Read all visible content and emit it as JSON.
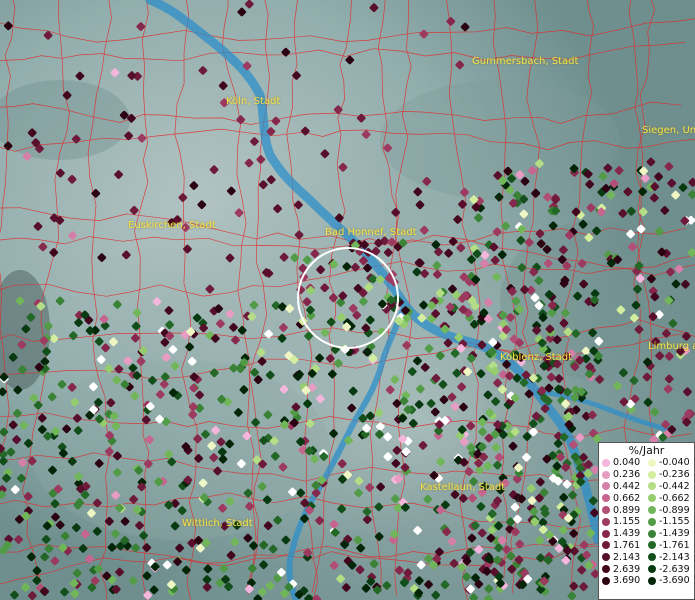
{
  "map": {
    "labels": [
      {
        "id": "koeln",
        "text": "Köln, Stadt"
      },
      {
        "id": "gummersbach",
        "text": "Gummersbach, Stadt"
      },
      {
        "id": "siegen",
        "text": "Siegen, Un"
      },
      {
        "id": "euskirchen",
        "text": "Euskirchen, Stadt"
      },
      {
        "id": "bad-honnef",
        "text": "Bad Honnef, Stadt"
      },
      {
        "id": "koblenz",
        "text": "Koblenz, Stadt"
      },
      {
        "id": "limburg",
        "text": "Limburg a."
      },
      {
        "id": "kastellaun",
        "text": "Kastellaun, Stadt"
      },
      {
        "id": "wittlich",
        "text": "Wittlich, Stadt"
      }
    ]
  },
  "legend": {
    "title": "%/Jahr",
    "positive": [
      {
        "value": "0.040",
        "color": "#f4b6dc"
      },
      {
        "value": "0.236",
        "color": "#e89cc4"
      },
      {
        "value": "0.442",
        "color": "#d67fa8"
      },
      {
        "value": "0.662",
        "color": "#c6658f"
      },
      {
        "value": "0.899",
        "color": "#b24f76"
      },
      {
        "value": "1.155",
        "color": "#9c3a60"
      },
      {
        "value": "1.439",
        "color": "#86284c"
      },
      {
        "value": "1.761",
        "color": "#6e1a3a"
      },
      {
        "value": "2.143",
        "color": "#580f2b"
      },
      {
        "value": "2.639",
        "color": "#42071e"
      },
      {
        "value": "3.690",
        "color": "#2b0212"
      }
    ],
    "negative": [
      {
        "value": "-0.040",
        "color": "#eef7c4"
      },
      {
        "value": "-0.236",
        "color": "#d3ee9e"
      },
      {
        "value": "-0.442",
        "color": "#b4de86"
      },
      {
        "value": "-0.662",
        "color": "#94cc6e"
      },
      {
        "value": "-0.899",
        "color": "#72b65a"
      },
      {
        "value": "-1.155",
        "color": "#539c47"
      },
      {
        "value": "-1.439",
        "color": "#3a8236"
      },
      {
        "value": "-1.761",
        "color": "#246828"
      },
      {
        "value": "-2.143",
        "color": "#134f1b"
      },
      {
        "value": "-2.639",
        "color": "#083a11"
      },
      {
        "value": "-3.690",
        "color": "#032508"
      }
    ]
  },
  "colors": {
    "river": "#2e8fc9",
    "borders": "#e02a2a",
    "label_text": "#f4e34a",
    "selection_circle": "#ffffff"
  }
}
